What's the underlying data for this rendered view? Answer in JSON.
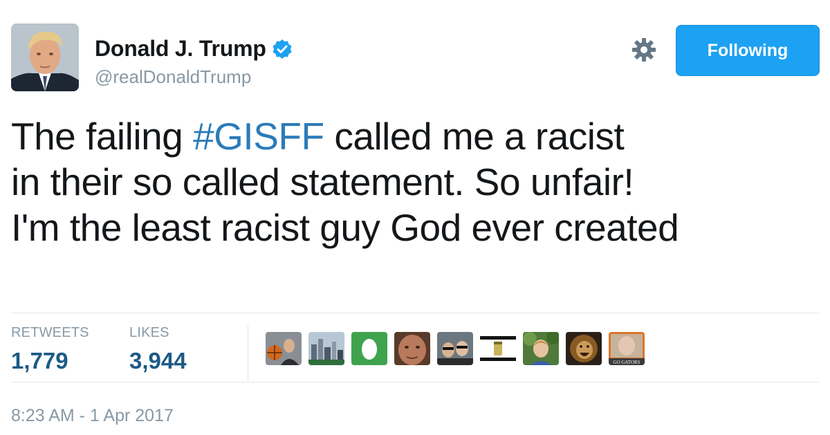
{
  "user": {
    "display_name": "Donald J. Trump",
    "handle": "@realDonaldTrump",
    "verified": true
  },
  "actions": {
    "follow_label": "Following",
    "settings_icon": "gear-icon"
  },
  "tweet": {
    "lines": [
      {
        "before": "The failing ",
        "hashtag": "#GISFF",
        "after": " called me a racist"
      },
      {
        "text": "in their so called statement. So unfair!"
      },
      {
        "text": "I'm the least racist guy God ever created"
      }
    ]
  },
  "stats": {
    "retweets_label": "RETWEETS",
    "retweets_value": "1,779",
    "likes_label": "LIKES",
    "likes_value": "3,944"
  },
  "liker_avatars": [
    {
      "icon": "avatar-person-basketball"
    },
    {
      "icon": "avatar-city-skyline"
    },
    {
      "icon": "avatar-default-egg"
    },
    {
      "icon": "avatar-face-closeup"
    },
    {
      "icon": "avatar-group-selfie"
    },
    {
      "icon": "avatar-striped-jar"
    },
    {
      "icon": "avatar-child-outdoors"
    },
    {
      "icon": "avatar-lion"
    },
    {
      "icon": "avatar-go-gators-logo",
      "caption": "GO GATORS"
    }
  ],
  "timestamp": "8:23 AM - 1 Apr 2017",
  "colors": {
    "accent": "#1da1f2",
    "hashtag": "#2b7bb9",
    "muted": "#8899a6",
    "stat_value": "#1c5a86"
  }
}
